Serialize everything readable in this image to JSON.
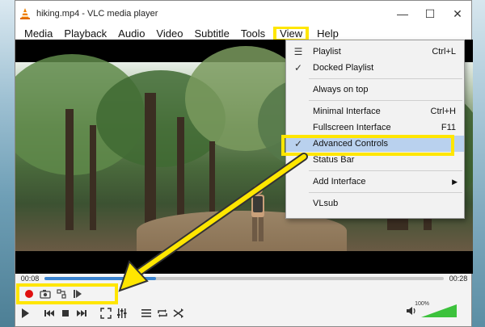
{
  "window": {
    "title": "hiking.mp4 - VLC media player",
    "controls": {
      "minimize": "—",
      "maximize": "☐",
      "close": "✕"
    }
  },
  "menubar": {
    "items": [
      "Media",
      "Playback",
      "Audio",
      "Video",
      "Subtitle",
      "Tools",
      "View",
      "Help"
    ]
  },
  "view_menu": {
    "items": [
      {
        "label": "Playlist",
        "shortcut": "Ctrl+L",
        "icon": "playlist-icon"
      },
      {
        "label": "Docked Playlist",
        "checked": true
      },
      {
        "label": "Always on top"
      },
      {
        "label": "Minimal Interface",
        "shortcut": "Ctrl+H"
      },
      {
        "label": "Fullscreen Interface",
        "shortcut": "F11"
      },
      {
        "label": "Advanced Controls",
        "checked": true,
        "highlighted": true
      },
      {
        "label": "Status Bar"
      },
      {
        "label": "Add Interface",
        "submenu": true
      },
      {
        "label": "VLsub"
      }
    ]
  },
  "playback": {
    "time_elapsed": "00:08",
    "time_total": "00:28",
    "progress": 0.28
  },
  "volume": {
    "label": "100%",
    "level": 1.0
  },
  "colors": {
    "highlight_box": "#ffe600",
    "seek_fill": "#3a83cf",
    "volume_fill": "#3cc23c"
  }
}
